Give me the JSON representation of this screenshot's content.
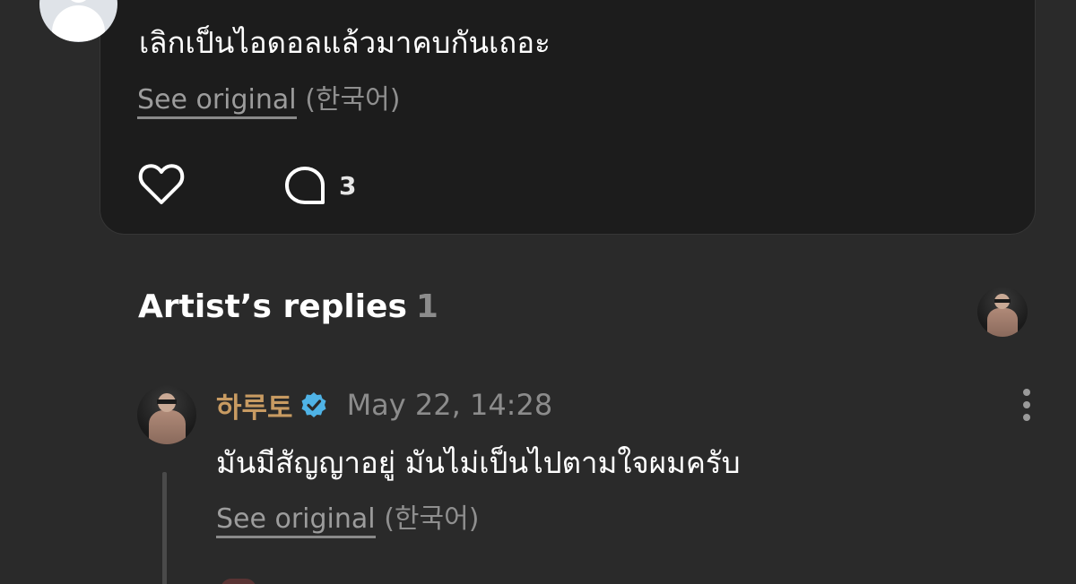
{
  "post": {
    "text": "เลิกเป็นไอดอลแล้วมาคบกันเถอะ",
    "see_original": "See original",
    "language": "(한국어)",
    "comment_count": "3"
  },
  "artist_replies": {
    "title": "Artist’s replies",
    "count": "1",
    "reply": {
      "author": "하루토",
      "timestamp": "May 22, 14:28",
      "text": "มันมีสัญญาอยู่ มันไม่เป็นไปตามใจผมครับ",
      "see_original": "See original",
      "language": "(한국어)"
    }
  },
  "colors": {
    "background": "#2a2a2a",
    "card": "#1c1c1c",
    "artist_name": "#c89b62",
    "verified_badge": "#4fb3e6",
    "muted_text": "#8c8c8c"
  },
  "icons": {
    "like": "heart-outline-icon",
    "comment": "speech-bubble-icon",
    "verified": "verified-badge-icon",
    "more": "vertical-dots-icon"
  }
}
